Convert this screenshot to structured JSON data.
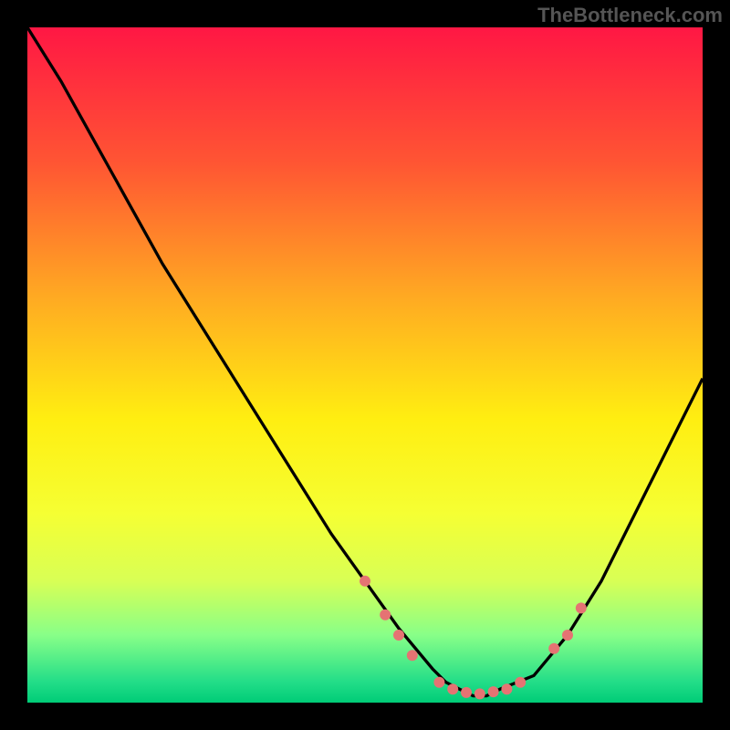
{
  "watermark": "TheBottleneck.com",
  "chart_data": {
    "type": "line",
    "title": "",
    "xlabel": "",
    "ylabel": "",
    "xlim": [
      0,
      100
    ],
    "ylim": [
      0,
      100
    ],
    "background_gradient": {
      "stops": [
        {
          "pos": 0,
          "color": "#ff1744"
        },
        {
          "pos": 20,
          "color": "#ff5533"
        },
        {
          "pos": 40,
          "color": "#ffaa22"
        },
        {
          "pos": 58,
          "color": "#ffee11"
        },
        {
          "pos": 72,
          "color": "#f5ff33"
        },
        {
          "pos": 82,
          "color": "#d8ff55"
        },
        {
          "pos": 90,
          "color": "#88ff88"
        },
        {
          "pos": 97,
          "color": "#22dd88"
        },
        {
          "pos": 100,
          "color": "#00cc77"
        }
      ]
    },
    "curve": {
      "x": [
        0,
        5,
        10,
        15,
        20,
        25,
        30,
        35,
        40,
        45,
        50,
        55,
        60,
        62,
        64,
        66,
        68,
        70,
        75,
        80,
        85,
        90,
        95,
        100
      ],
      "y": [
        100,
        92,
        83,
        74,
        65,
        57,
        49,
        41,
        33,
        25,
        18,
        11,
        5,
        3,
        2,
        1,
        1,
        2,
        4,
        10,
        18,
        28,
        38,
        48
      ]
    },
    "markers": {
      "color": "#e57373",
      "radius": 6,
      "points": [
        {
          "x": 50,
          "y": 18
        },
        {
          "x": 53,
          "y": 13
        },
        {
          "x": 55,
          "y": 10
        },
        {
          "x": 57,
          "y": 7
        },
        {
          "x": 61,
          "y": 3
        },
        {
          "x": 63,
          "y": 2
        },
        {
          "x": 65,
          "y": 1.5
        },
        {
          "x": 67,
          "y": 1.3
        },
        {
          "x": 69,
          "y": 1.6
        },
        {
          "x": 71,
          "y": 2
        },
        {
          "x": 73,
          "y": 3
        },
        {
          "x": 78,
          "y": 8
        },
        {
          "x": 80,
          "y": 10
        },
        {
          "x": 82,
          "y": 14
        }
      ]
    }
  }
}
